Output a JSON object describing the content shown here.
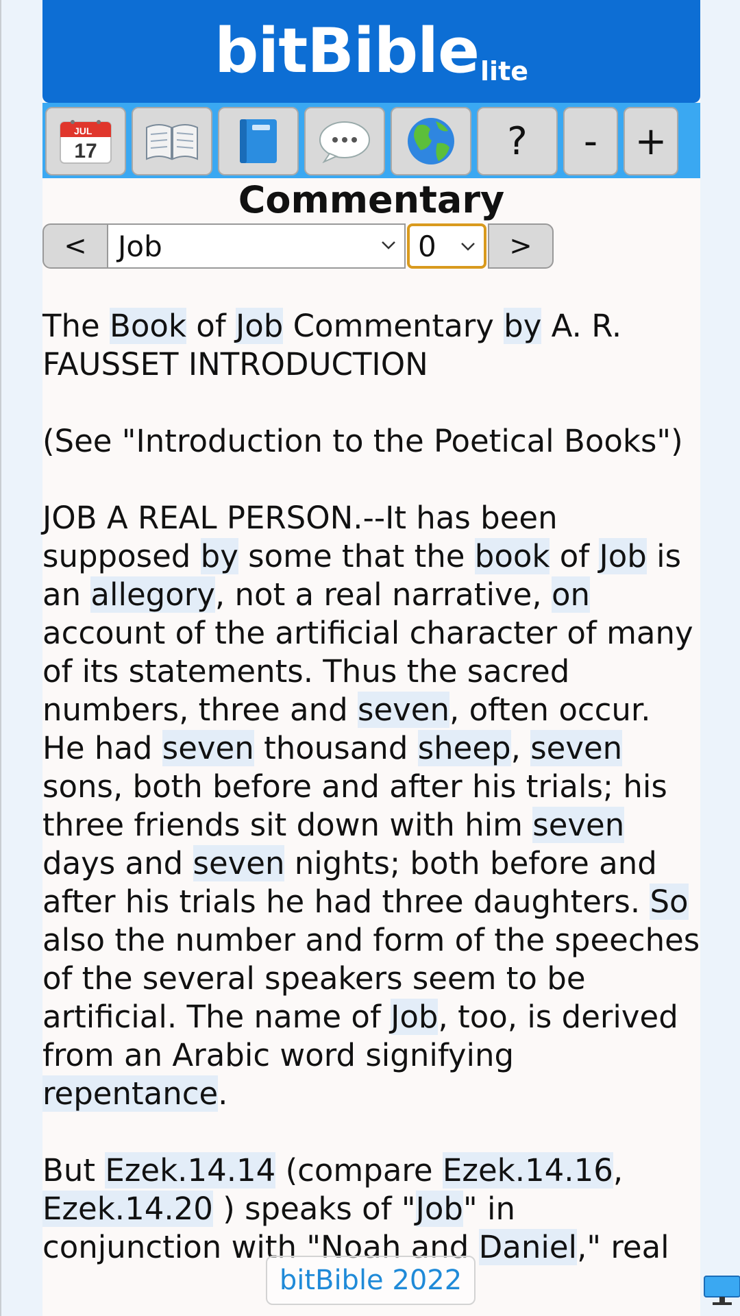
{
  "header": {
    "title": "bitBible",
    "subtitle": "lite"
  },
  "toolbar": {
    "calendar_month": "JUL",
    "calendar_day": "17",
    "help_label": "?",
    "decrease_label": "-",
    "increase_label": "+"
  },
  "page": {
    "title": "Commentary"
  },
  "nav": {
    "prev_label": "<",
    "next_label": ">",
    "book_selected": "Job",
    "chapter_selected": "0"
  },
  "content": {
    "paragraphs": [
      [
        {
          "t": "The "
        },
        {
          "t": "Book",
          "h": true
        },
        {
          "t": " of "
        },
        {
          "t": "Job",
          "h": true
        },
        {
          "t": " Commentary "
        },
        {
          "t": "by",
          "h": true
        },
        {
          "t": " A. R. FAUSSET INTRODUCTION"
        }
      ],
      [
        {
          "t": "(See \"Introduction to the Poetical Books\")"
        }
      ],
      [
        {
          "t": "JOB A REAL PERSON.--It has been supposed "
        },
        {
          "t": "by",
          "h": true
        },
        {
          "t": " some that the "
        },
        {
          "t": "book",
          "h": true
        },
        {
          "t": " of "
        },
        {
          "t": "Job",
          "h": true
        },
        {
          "t": " is an "
        },
        {
          "t": "allegory",
          "h": true
        },
        {
          "t": ", not a real narrative, "
        },
        {
          "t": "on",
          "h": true
        },
        {
          "t": " account of the artificial character of many of its statements. Thus the sacred numbers, three and "
        },
        {
          "t": "seven",
          "h": true
        },
        {
          "t": ", often occur. He had "
        },
        {
          "t": "seven",
          "h": true
        },
        {
          "t": " thousand "
        },
        {
          "t": "sheep",
          "h": true
        },
        {
          "t": ", "
        },
        {
          "t": "seven",
          "h": true
        },
        {
          "t": " sons, both before and after his trials; his three friends sit down with him "
        },
        {
          "t": "seven",
          "h": true
        },
        {
          "t": " days and "
        },
        {
          "t": "seven",
          "h": true
        },
        {
          "t": " nights; both before and after his trials he had three daughters. "
        },
        {
          "t": "So",
          "h": true
        },
        {
          "t": " also the number and form of the speeches of the several speakers seem to be artificial. The name of "
        },
        {
          "t": "Job",
          "h": true
        },
        {
          "t": ", too, is derived from an Arabic word signifying "
        },
        {
          "t": "repentance",
          "h": true
        },
        {
          "t": "."
        }
      ],
      [
        {
          "t": "But "
        },
        {
          "t": "Ezek.14.14",
          "h": true
        },
        {
          "t": " (compare "
        },
        {
          "t": "Ezek.14.16",
          "h": true
        },
        {
          "t": ", "
        },
        {
          "t": "Ezek.14.20",
          "h": true
        },
        {
          "t": " ) speaks of \""
        },
        {
          "t": "Job",
          "h": true
        },
        {
          "t": "\" in conjunction with \"Noah and "
        },
        {
          "t": "Daniel",
          "h": true
        },
        {
          "t": ",\" real"
        }
      ]
    ]
  },
  "footer": {
    "badge": "bitBible 2022"
  },
  "colors": {
    "header": "#0d6ed4",
    "toolbar": "#3aa8f2",
    "highlight": "#e3edf8",
    "chapter_border": "#d99a1e"
  }
}
